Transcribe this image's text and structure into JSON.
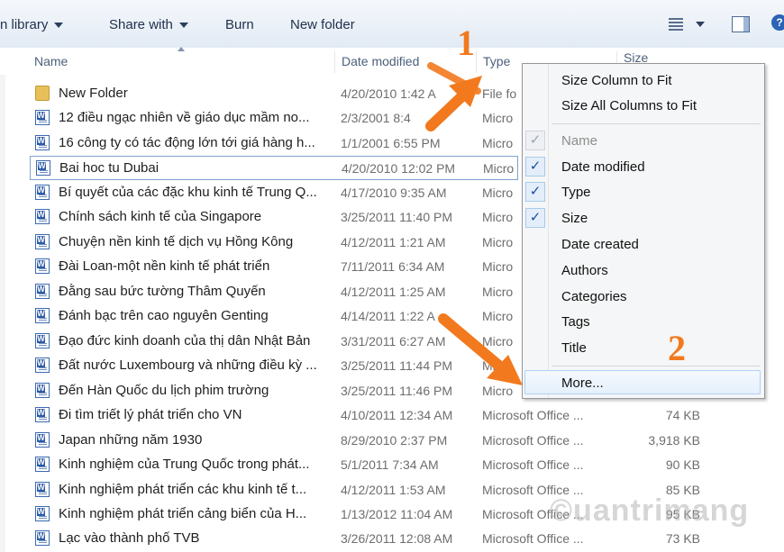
{
  "toolbar": {
    "include_library": "n library",
    "share_with": "Share with",
    "burn": "Burn",
    "new_folder": "New folder"
  },
  "columns": {
    "name": "Name",
    "date_modified": "Date modified",
    "type": "Type",
    "size": "Size"
  },
  "files": [
    {
      "name": "New Folder",
      "date": "4/20/2010 1:42 A",
      "type": "File fo",
      "size": "",
      "icon": "folder-icon"
    },
    {
      "name": "12 điều ngạc nhiên về giáo dục mầm no...",
      "date": "2/3/2001 8:4",
      "type": "Micro",
      "size": "",
      "icon": "word-document-icon"
    },
    {
      "name": "16 công ty có tác động lớn tới giá hàng h...",
      "date": "1/1/2001 6:55 PM",
      "type": "Micro",
      "size": "",
      "icon": "word-document-icon"
    },
    {
      "name": "Bai hoc tu Dubai",
      "date": "4/20/2010 12:02 PM",
      "type": "Micro",
      "size": "",
      "icon": "word-document-icon"
    },
    {
      "name": "Bí quyết của các đặc khu kinh tế Trung Q...",
      "date": "4/17/2010 9:35 AM",
      "type": "Micro",
      "size": "",
      "icon": "word-document-icon"
    },
    {
      "name": "Chính sách kinh tế của Singapore",
      "date": "3/25/2011 11:40 PM",
      "type": "Micro",
      "size": "",
      "icon": "word-document-icon"
    },
    {
      "name": "Chuyện nền kinh tế dịch vụ Hồng Kông",
      "date": "4/12/2011 1:21 AM",
      "type": "Micro",
      "size": "",
      "icon": "word-document-icon"
    },
    {
      "name": "Đài Loan-một nền kinh tế phát triển",
      "date": "7/11/2011 6:34 AM",
      "type": "Micro",
      "size": "",
      "icon": "word-document-icon"
    },
    {
      "name": "Đằng sau bức tường Thâm Quyến",
      "date": "4/12/2011 1:25 AM",
      "type": "Micro",
      "size": "",
      "icon": "word-document-icon"
    },
    {
      "name": "Đánh bạc trên cao nguyên Genting",
      "date": "4/14/2011 1:22 A",
      "type": "Micro",
      "size": "",
      "icon": "word-document-icon"
    },
    {
      "name": "Đạo đức kinh doanh của thị dân Nhật Bản",
      "date": "3/31/2011 6:27 AM",
      "type": "Micro",
      "size": "",
      "icon": "word-document-icon"
    },
    {
      "name": "Đất nước Luxembourg và những điều kỳ ...",
      "date": "3/25/2011 11:44 PM",
      "type": "Mic",
      "size": "",
      "icon": "word-document-icon"
    },
    {
      "name": "Đến Hàn Quốc du lịch phim trường",
      "date": "3/25/2011 11:46 PM",
      "type": "Micro",
      "size": "",
      "icon": "word-document-icon"
    },
    {
      "name": "Đi tìm triết lý phát triển cho VN",
      "date": "4/10/2011 12:34 AM",
      "type": "Microsoft Office ...",
      "size": "74 KB",
      "icon": "word-document-icon"
    },
    {
      "name": "Japan những năm 1930",
      "date": "8/29/2010 2:37 PM",
      "type": "Microsoft Office ...",
      "size": "3,918 KB",
      "icon": "word-document-icon"
    },
    {
      "name": "Kinh nghiệm của Trung Quốc trong phát...",
      "date": "5/1/2011 7:34 AM",
      "type": "Microsoft Office ...",
      "size": "90 KB",
      "icon": "word-document-icon"
    },
    {
      "name": "Kinh nghiệm phát triển các khu kinh tế t...",
      "date": "4/12/2011 1:53 AM",
      "type": "Microsoft Office ...",
      "size": "85 KB",
      "icon": "word-document-icon"
    },
    {
      "name": "Kinh nghiệm phát triển cảng biển của H...",
      "date": "1/13/2012 11:04 AM",
      "type": "Microsoft Office ...",
      "size": "95 KB",
      "icon": "word-document-icon"
    },
    {
      "name": "Lạc vào thành phố TVB",
      "date": "3/26/2011 12:08 AM",
      "type": "Microsoft Office ...",
      "size": "73 KB",
      "icon": "word-document-icon"
    }
  ],
  "context_menu": {
    "size_column_to_fit": "Size Column to Fit",
    "size_all_columns_to_fit": "Size All Columns to Fit",
    "items": [
      {
        "label": "Name",
        "checked": true,
        "disabled": true
      },
      {
        "label": "Date modified",
        "checked": true,
        "disabled": false
      },
      {
        "label": "Type",
        "checked": true,
        "disabled": false
      },
      {
        "label": "Size",
        "checked": true,
        "disabled": false
      },
      {
        "label": "Date created",
        "checked": false,
        "disabled": false
      },
      {
        "label": "Authors",
        "checked": false,
        "disabled": false
      },
      {
        "label": "Categories",
        "checked": false,
        "disabled": false
      },
      {
        "label": "Tags",
        "checked": false,
        "disabled": false
      },
      {
        "label": "Title",
        "checked": false,
        "disabled": false
      }
    ],
    "more": "More..."
  },
  "annotations": {
    "step1": "1",
    "step2": "2",
    "color": "#f2791d"
  },
  "watermark": "©uantrimang"
}
